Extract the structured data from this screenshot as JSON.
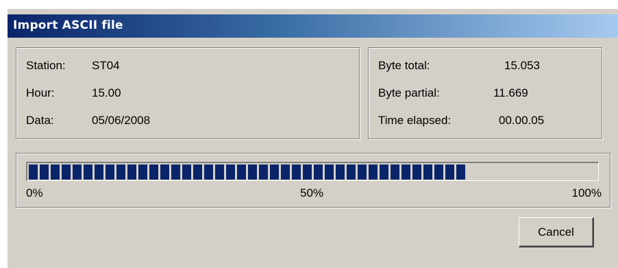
{
  "window": {
    "title": "Import ASCII file"
  },
  "info_left": {
    "station_label": "Station:",
    "station_value": "ST04",
    "hour_label": "Hour:",
    "hour_value": "15.00",
    "data_label": "Data:",
    "data_value": "05/06/2008"
  },
  "info_right": {
    "byte_total_label": "Byte total:",
    "byte_total_value": "15.053",
    "byte_partial_label": "Byte partial:",
    "byte_partial_value": "11.669",
    "time_elapsed_label": "Time elapsed:",
    "time_elapsed_value": "00.00.05"
  },
  "progress": {
    "fraction": 0.776,
    "tick_start": "0%",
    "tick_middle": "50%",
    "tick_end": "100%",
    "bar_color": "#0a246a"
  },
  "buttons": {
    "cancel_label": "Cancel"
  }
}
